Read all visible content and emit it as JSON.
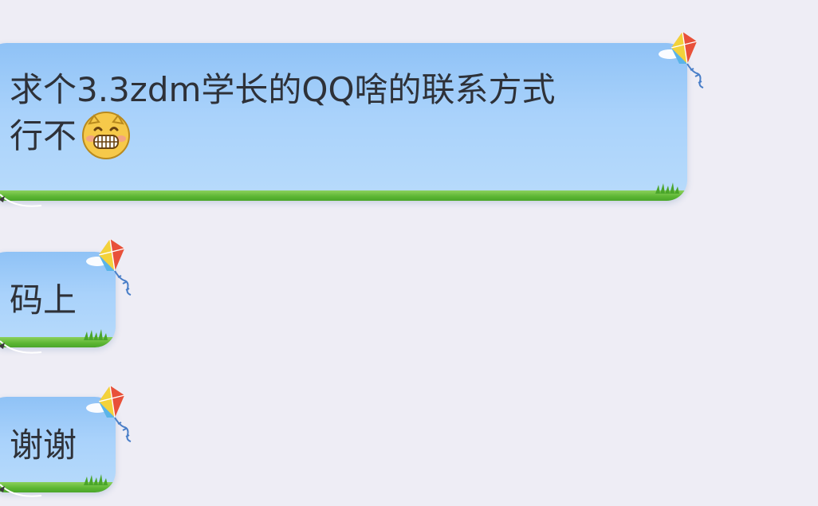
{
  "messages": [
    {
      "id": "m1",
      "line1": "求个3.3zdm学长的QQ啥的联系方式",
      "line2": "行不",
      "emoji": "grin-face-icon"
    },
    {
      "id": "m2",
      "line1": "码上"
    },
    {
      "id": "m3",
      "line1": "谢谢"
    }
  ],
  "theme": {
    "background": "#eeedf5",
    "bubble_top": "#8fc2f6",
    "bubble_bottom": "#b8dbfb",
    "grass": "#5bb532",
    "text": "#2e3138"
  },
  "decorations": {
    "bubble_icon": "kite-icon",
    "bubble_footer": "grass-strip"
  }
}
